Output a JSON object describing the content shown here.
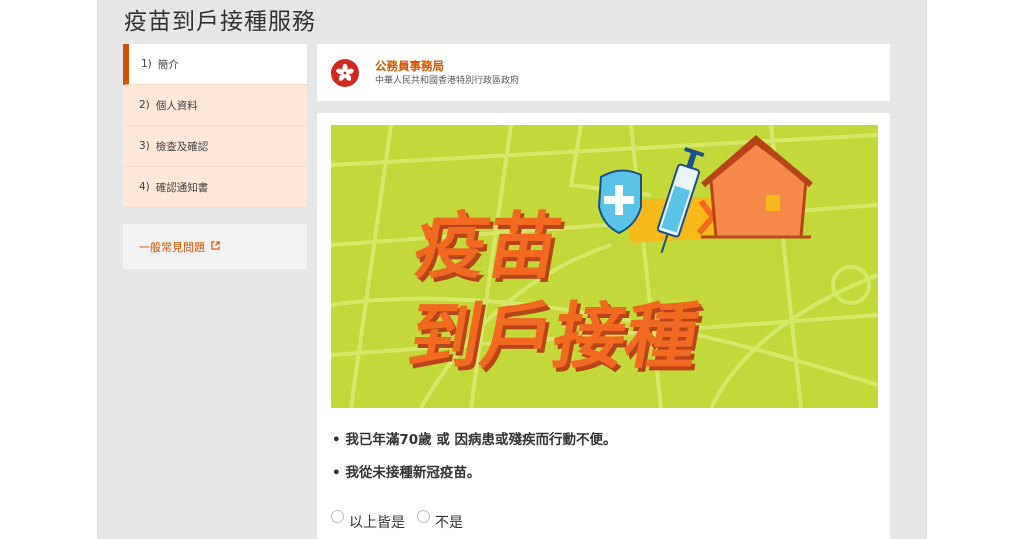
{
  "page": {
    "title": "疫苗到戶接種服務"
  },
  "steps": [
    {
      "num": "1)",
      "label": "簡介",
      "active": true
    },
    {
      "num": "2)",
      "label": "個人資料",
      "active": false
    },
    {
      "num": "3)",
      "label": "檢查及確認",
      "active": false
    },
    {
      "num": "4)",
      "label": "確認通知書",
      "active": false
    }
  ],
  "faq": {
    "label": "一般常見問題",
    "icon": "external-link-icon"
  },
  "department": {
    "name": "公務員事務局",
    "government": "中華人民共和國香港特別行政區政府",
    "icon": "bauhinia-emblem-icon"
  },
  "banner": {
    "line1": "疫苗",
    "line2": "到戶接種",
    "icons": [
      "shield-cross-icon",
      "syringe-icon",
      "arrow-chevrons-icon",
      "house-icon"
    ],
    "colors": {
      "background": "#c3d93a",
      "text": "#f26a21",
      "shadow": "#b8451a"
    }
  },
  "criteria": [
    "• 我已年滿70歲 或 因病患或殘疾而行動不便。",
    "• 我從未接種新冠疫苗。"
  ],
  "options": [
    {
      "label": "以上皆是"
    },
    {
      "label": "不是"
    }
  ],
  "colors": {
    "accent": "#d35400",
    "step_bg": "#fde7d6",
    "frame_bg": "#e6e6e6"
  }
}
